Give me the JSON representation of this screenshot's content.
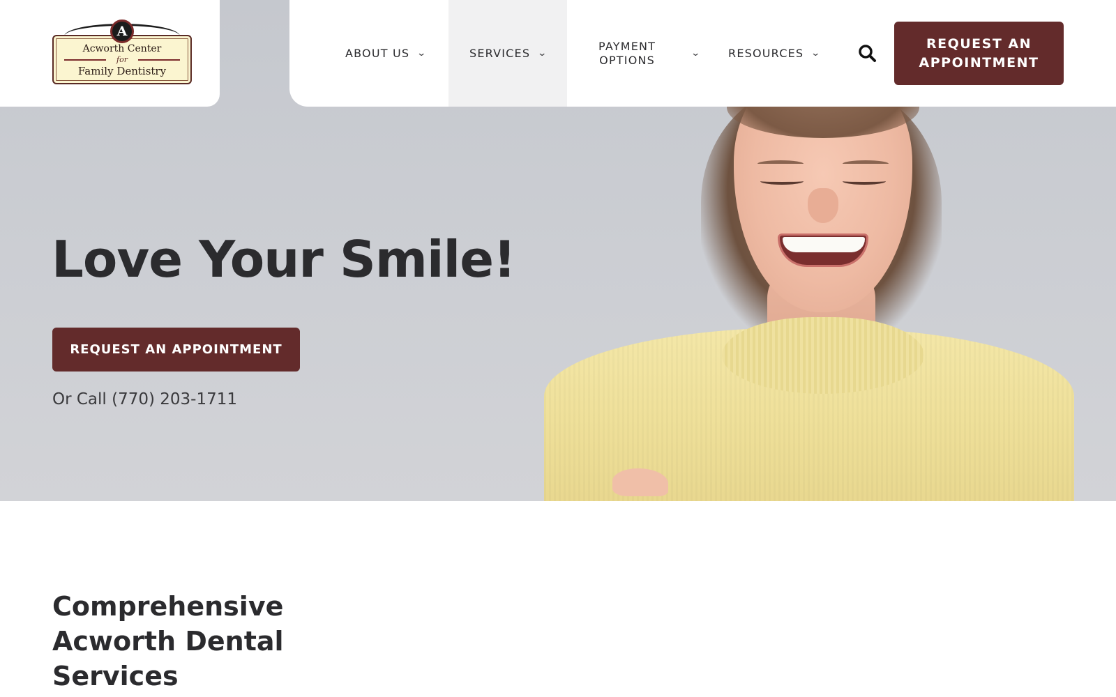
{
  "logo": {
    "medal_letter": "A",
    "line1": "Acworth Center",
    "line2": "for",
    "line3": "Family Dentistry"
  },
  "nav": {
    "items": [
      {
        "label": "ABOUT US",
        "icon": "chevron-down-icon"
      },
      {
        "label": "SERVICES",
        "icon": "chevron-down-icon",
        "active": true
      },
      {
        "label_line1": "PAYMENT",
        "label_line2": "OPTIONS",
        "icon": "chevron-down-icon"
      },
      {
        "label": "RESOURCES",
        "icon": "chevron-down-icon"
      }
    ],
    "search_icon": "search-icon",
    "cta_line1": "REQUEST AN",
    "cta_line2": "APPOINTMENT"
  },
  "hero": {
    "title": "Love Your Smile!",
    "cta_label": "REQUEST AN APPOINTMENT",
    "call_text": "Or Call (770) 203-1711"
  },
  "section": {
    "title_line1": "Comprehensive",
    "title_line2": "Acworth Dental",
    "title_line3": "Services"
  },
  "colors": {
    "brand": "#632b2b",
    "text": "#2b2b2e",
    "hero_bg": "#cdcfd4",
    "logo_bg": "#fbf5d0"
  }
}
